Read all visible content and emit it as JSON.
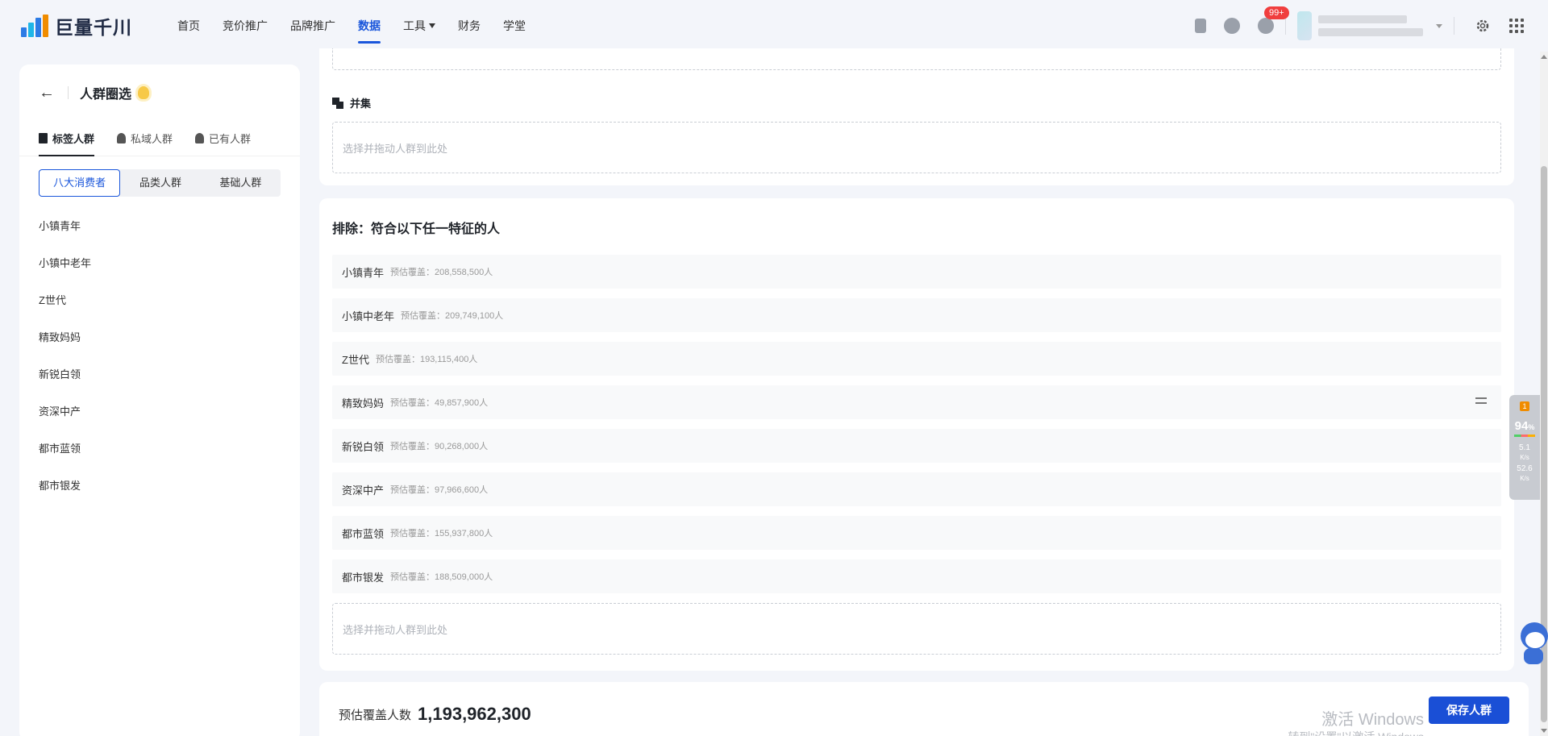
{
  "header": {
    "logo_text": "巨量千川",
    "nav": [
      {
        "label": "首页",
        "active": false
      },
      {
        "label": "竞价推广",
        "active": false
      },
      {
        "label": "品牌推广",
        "active": false
      },
      {
        "label": "数据",
        "active": true
      },
      {
        "label": "工具",
        "active": false,
        "dropdown": true
      },
      {
        "label": "财务",
        "active": false
      },
      {
        "label": "学堂",
        "active": false
      }
    ],
    "notification_badge": "99+",
    "icons": [
      "document-icon",
      "help-icon",
      "message-icon",
      "settings-icon",
      "apps-grid-icon"
    ]
  },
  "left_panel": {
    "title": "人群圈选",
    "tabs": [
      {
        "label": "标签人群",
        "active": true
      },
      {
        "label": "私域人群",
        "active": false
      },
      {
        "label": "已有人群",
        "active": false
      }
    ],
    "segments": [
      {
        "label": "八大消费者",
        "active": true
      },
      {
        "label": "品类人群",
        "active": false
      },
      {
        "label": "基础人群",
        "active": false
      }
    ],
    "items": [
      "小镇青年",
      "小镇中老年",
      "Z世代",
      "精致妈妈",
      "新锐白领",
      "资深中产",
      "都市蓝领",
      "都市银发"
    ]
  },
  "union": {
    "title": "并集",
    "drop_placeholder": "选择并拖动人群到此处"
  },
  "exclude": {
    "title": "排除：符合以下任一特征的人",
    "cover_prefix": "预估覆盖：",
    "rows": [
      {
        "name": "小镇青年",
        "cover": "预估覆盖：208,558,500人"
      },
      {
        "name": "小镇中老年",
        "cover": "预估覆盖：209,749,100人"
      },
      {
        "name": "Z世代",
        "cover": "预估覆盖：193,115,400人"
      },
      {
        "name": "精致妈妈",
        "cover": "预估覆盖：49,857,900人"
      },
      {
        "name": "新锐白领",
        "cover": "预估覆盖：90,268,000人"
      },
      {
        "name": "资深中产",
        "cover": "预估覆盖：97,966,600人"
      },
      {
        "name": "都市蓝领",
        "cover": "预估覆盖：155,937,800人"
      },
      {
        "name": "都市银发",
        "cover": "预估覆盖：188,509,000人"
      }
    ],
    "drop_placeholder": "选择并拖动人群到此处"
  },
  "footer": {
    "label": "预估覆盖人数",
    "value": "1,193,962,300",
    "save_label": "保存人群",
    "watermark": "激活 Windows",
    "watermark_sub": "转到\"设置\"以激活 Windows"
  },
  "widget": {
    "badge": "1",
    "percent": "94",
    "percent_unit": "%",
    "upload": "5.1",
    "download": "52.6",
    "speed_unit": "K/s"
  }
}
